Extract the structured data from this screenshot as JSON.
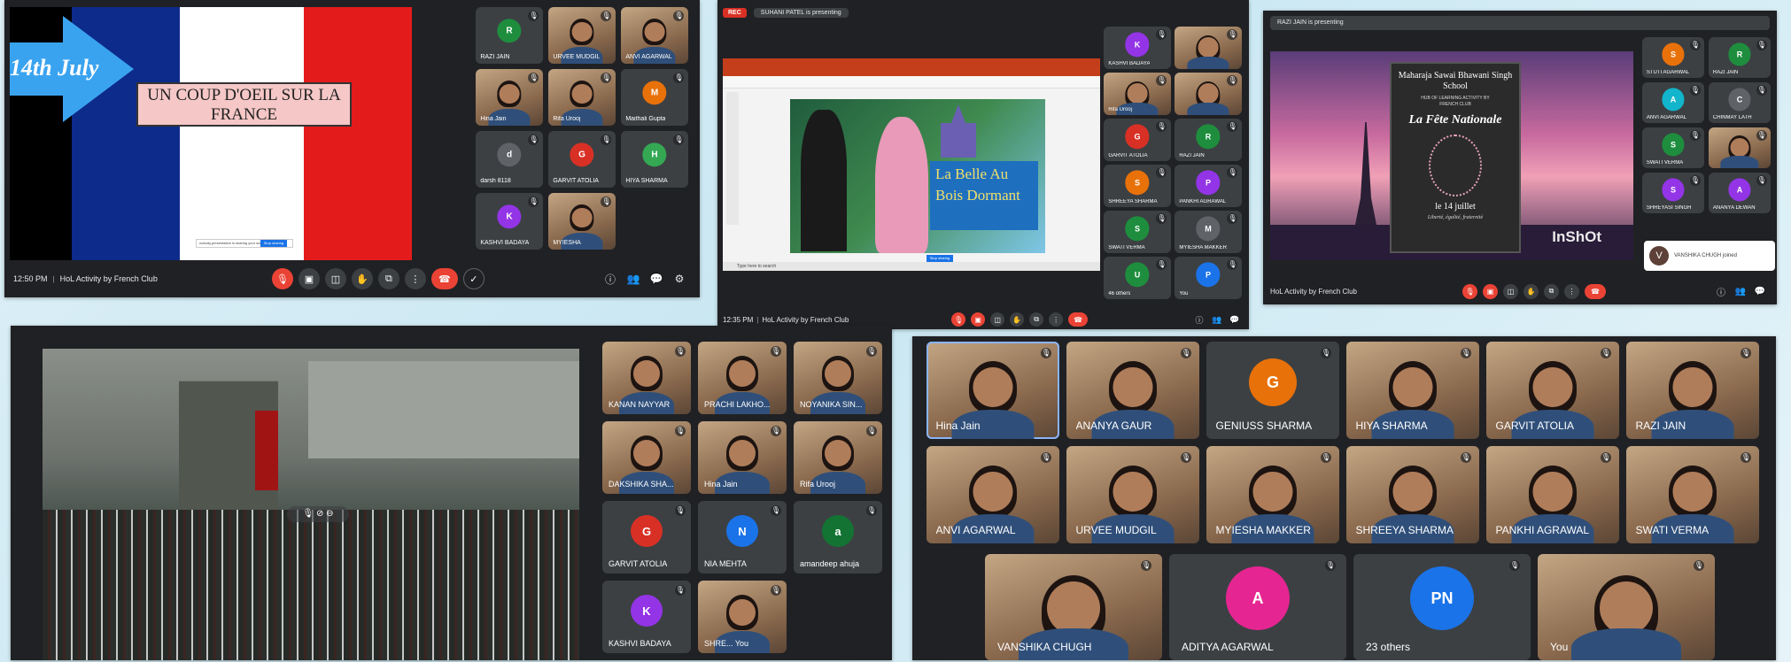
{
  "s1": {
    "banner": "14th July",
    "banner_sup": "th",
    "title": "UN COUP D'OEIL SUR LA FRANCE",
    "time": "12:50 PM",
    "meeting": "HoL Activity by French Club",
    "slide_btn": "Stop sharing",
    "slide_text": "nobody.presentation is sharing your screen",
    "tiles": [
      {
        "n": "RAZI JAIN",
        "l": "R",
        "c": "#1e8e3e"
      },
      {
        "n": "URVEE MUDGIL",
        "v": 1
      },
      {
        "n": "ANVI AGARWAL",
        "v": 1
      },
      {
        "n": "Hina Jain",
        "v": 1
      },
      {
        "n": "Rifa Urooj",
        "v": 1
      },
      {
        "n": "Maithali Gupta",
        "l": "M",
        "c": "#e8710a"
      },
      {
        "n": "darsh 8118",
        "l": "d",
        "c": "#5f6368"
      },
      {
        "n": "GARVIT ATOLIA",
        "l": "G",
        "c": "#d93025"
      },
      {
        "n": "HIYA SHARMA",
        "l": "H",
        "c": "#34a853"
      },
      {
        "n": "KASHVI BADAYA",
        "l": "K",
        "c": "#9334e6"
      },
      {
        "n": "MYIESHA",
        "v": 1
      }
    ]
  },
  "s2": {
    "rec": "REC",
    "presenting": "SUHANI PATEL is presenting",
    "time": "12:35 PM",
    "meeting": "HoL Activity by French Club",
    "slide_title": "La Belle Au Bois Dormant",
    "taskbar_search": "Type here to search",
    "slide_btn": "Stop sharing",
    "tiles": [
      {
        "n": "KASHVI BADAYA",
        "l": "K",
        "c": "#9334e6"
      },
      {
        "n": "",
        "v": 1
      },
      {
        "n": "Rifa Urooj",
        "v": 1
      },
      {
        "n": "",
        "v": 1
      },
      {
        "n": "GARVIT ATOLIA",
        "l": "G",
        "c": "#d93025"
      },
      {
        "n": "RAZI JAIN",
        "l": "R",
        "c": "#1e8e3e"
      },
      {
        "n": "SHREEYA SHARMA",
        "l": "S",
        "c": "#e8710a"
      },
      {
        "n": "PANKHI AGRAWAL",
        "l": "P",
        "c": "#9334e6"
      },
      {
        "n": "SWATI VERMA",
        "l": "S",
        "c": "#1e8e3e"
      },
      {
        "n": "MYIESHA MAKKER",
        "l": "M",
        "c": "#5f6368"
      },
      {
        "n": "46 others",
        "l": "U",
        "c": "#1e8e3e"
      },
      {
        "n": "You",
        "l": "P",
        "c": "#1a73e8"
      }
    ]
  },
  "s3": {
    "presenting": "RAZI JAIN is presenting",
    "school": "Maharaja Sawai Bhawani Singh School",
    "hub": "HUB OF LEARNING ACTIVITY BY FRENCH CLUB",
    "fete": "La Fête Nationale",
    "date": "le 14 juillet",
    "motto": "Liberté, égalité, fraternité",
    "brand": "InShOt",
    "meeting": "HoL Activity by French Club",
    "joined": "VANSHIKA CHUGH joined",
    "joined_l": "V",
    "tiles": [
      {
        "n": "STUTI AGARWAL",
        "l": "S",
        "c": "#e8710a"
      },
      {
        "n": "RAZI JAIN",
        "l": "R",
        "c": "#1e8e3e"
      },
      {
        "n": "ANVI AGARWAL",
        "l": "A",
        "c": "#12b5cb"
      },
      {
        "n": "CHINMAY LATH",
        "l": "C",
        "c": "#5f6368"
      },
      {
        "n": "SWATI VERMA",
        "l": "S",
        "c": "#1e8e3e"
      },
      {
        "n": "",
        "v": 1
      },
      {
        "n": "SHREYASI SINGH",
        "l": "S",
        "c": "#9334e6"
      },
      {
        "n": "ANANYA DEWAN",
        "l": "A",
        "c": "#9334e6"
      }
    ]
  },
  "s4": {
    "tiles": [
      {
        "n": "KANAN NAYYAR",
        "v": 1
      },
      {
        "n": "PRACHI LAKHO...",
        "v": 1
      },
      {
        "n": "NOYANIKA SIN...",
        "v": 1
      },
      {
        "n": "DAKSHIKA SHA...",
        "v": 1
      },
      {
        "n": "Hina Jain",
        "v": 1
      },
      {
        "n": "Rifa Urooj",
        "v": 1
      },
      {
        "n": "GARVIT ATOLIA",
        "l": "G",
        "c": "#d93025"
      },
      {
        "n": "NIA MEHTA",
        "l": "N",
        "c": "#1a73e8"
      },
      {
        "n": "amandeep ahuja",
        "l": "a",
        "c": "#137333"
      },
      {
        "n": "KASHVI BADAYA",
        "l": "K",
        "c": "#9334e6"
      },
      {
        "n": "SHRE... You",
        "v": 1
      }
    ]
  },
  "s5": {
    "tiles": [
      {
        "n": "Hina Jain",
        "v": 1,
        "a": 1
      },
      {
        "n": "ANANYA GAUR",
        "v": 1
      },
      {
        "n": "GENIUSS SHARMA",
        "l": "G",
        "c": "#e8710a"
      },
      {
        "n": "HIYA SHARMA",
        "v": 1
      },
      {
        "n": "GARVIT ATOLIA",
        "v": 1
      },
      {
        "n": "RAZI JAIN",
        "v": 1
      },
      {
        "n": "ANVI AGARWAL",
        "v": 1
      },
      {
        "n": "URVEE MUDGIL",
        "v": 1
      },
      {
        "n": "MYIESHA MAKKER",
        "v": 1
      },
      {
        "n": "SHREEYA SHARMA",
        "v": 1
      },
      {
        "n": "PANKHI AGRAWAL",
        "v": 1
      },
      {
        "n": "SWATI VERMA",
        "v": 1
      },
      {
        "n": "VANSHIKA CHUGH",
        "v": 1
      },
      {
        "n": "ADITYA AGARWAL",
        "l": "A",
        "c": "#e52592"
      },
      {
        "n": "23 others",
        "l": "PN",
        "c": "#1a73e8"
      },
      {
        "n": "You",
        "v": 1
      }
    ]
  }
}
